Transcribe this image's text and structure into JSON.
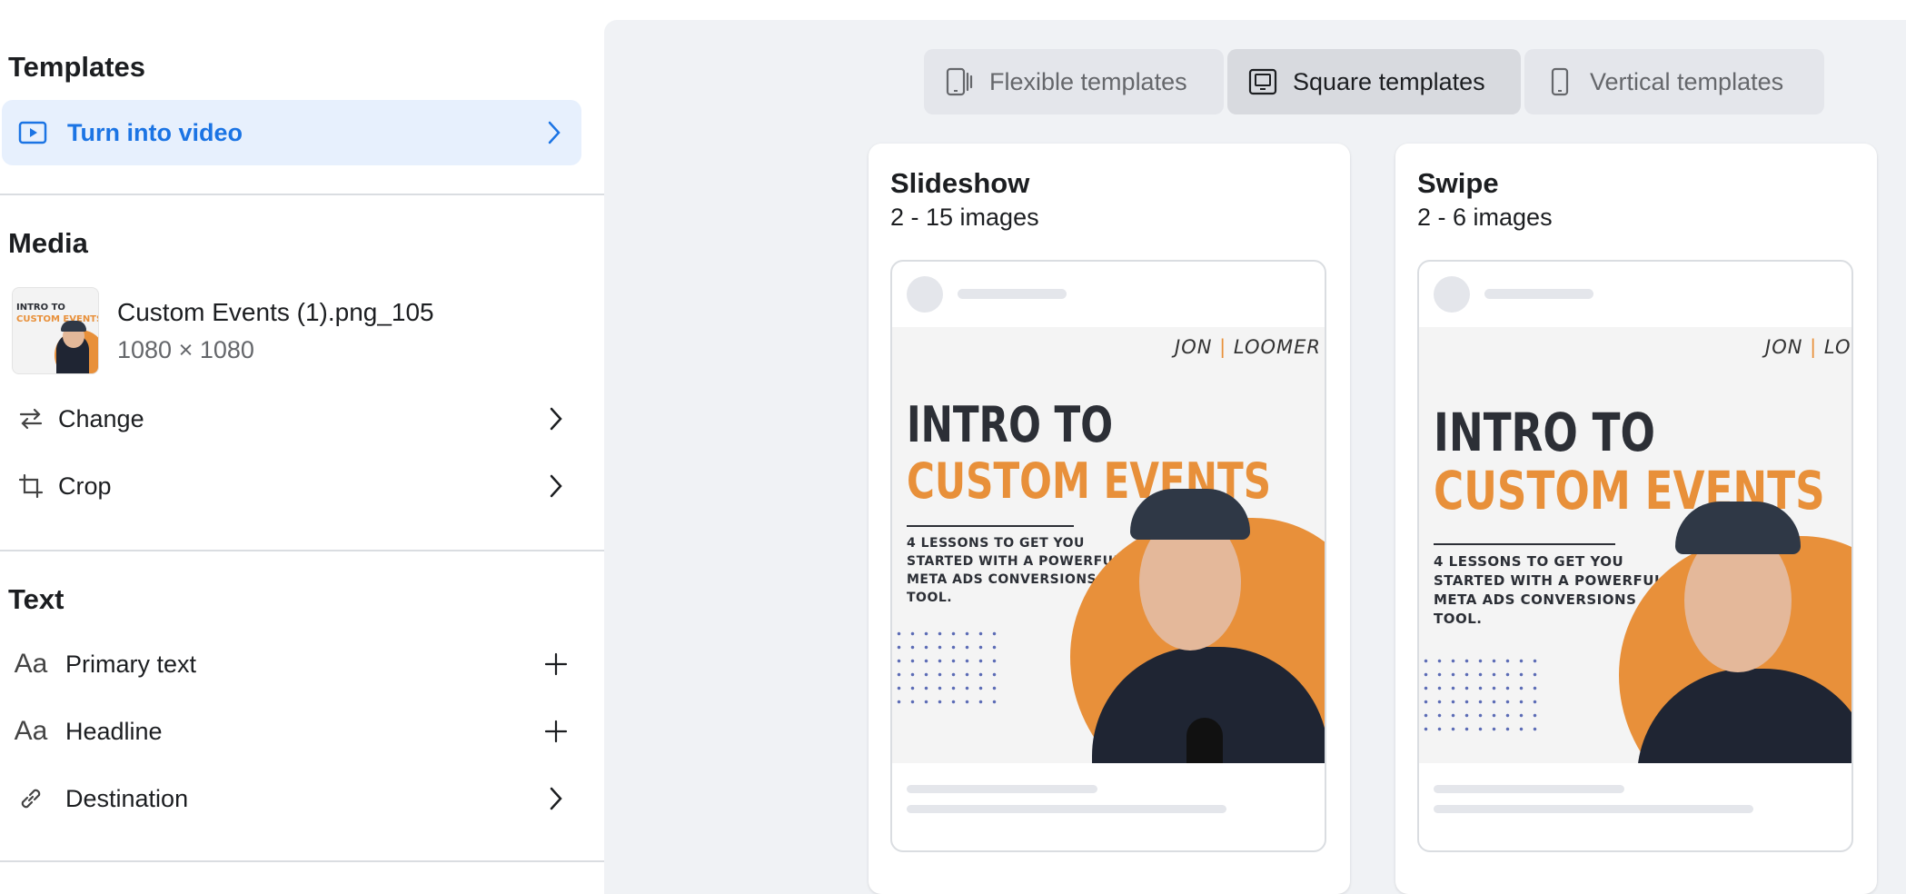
{
  "left_panel": {
    "templates": {
      "title": "Templates",
      "turn_into_video": "Turn into video"
    },
    "media": {
      "title": "Media",
      "file_name": "Custom Events (1).png_105",
      "dimensions": "1080 × 1080",
      "thumb_title_1": "INTRO TO",
      "thumb_title_2": "CUSTOM EVENTS",
      "change_label": "Change",
      "crop_label": "Crop"
    },
    "text": {
      "title": "Text",
      "primary_text_label": "Primary text",
      "headline_label": "Headline",
      "destination_label": "Destination"
    }
  },
  "template_tabs": [
    {
      "label": "Flexible templates",
      "icon": "flexible-device-icon",
      "selected": false
    },
    {
      "label": "Square templates",
      "icon": "square-device-icon",
      "selected": true
    },
    {
      "label": "Vertical templates",
      "icon": "phone-icon",
      "selected": false
    }
  ],
  "cards": [
    {
      "title": "Slideshow",
      "subtitle": "2 - 15 images"
    },
    {
      "title": "Swipe",
      "subtitle": "2 - 6 images"
    }
  ],
  "creative": {
    "logo_part1": "JON",
    "logo_part2": "LOOMER",
    "headline_1": "INTRO TO",
    "headline_2": "CUSTOM EVENTS",
    "body": "4 LESSONS TO GET YOU STARTED WITH A POWERFUL META ADS CONVERSIONS TOOL."
  },
  "colors": {
    "accent_blue": "#1b74e4",
    "active_bg": "#e7f0fd",
    "panel_bg": "#f0f2f5",
    "brand_orange": "#e8903a"
  }
}
